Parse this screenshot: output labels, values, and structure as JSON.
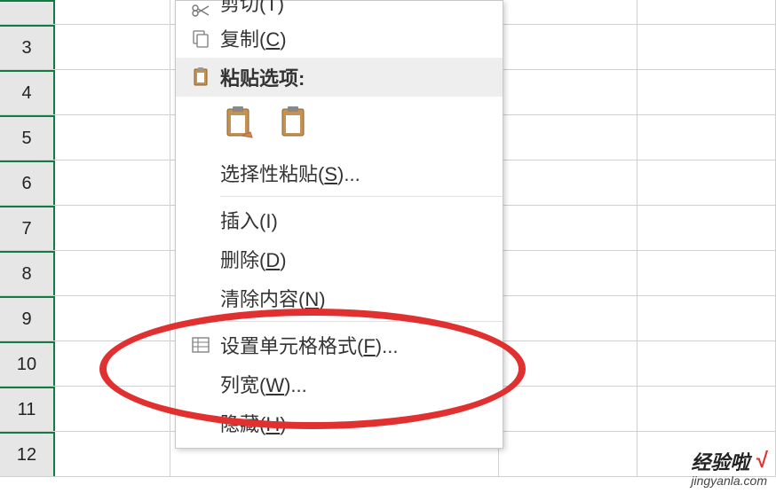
{
  "rows": [
    "",
    "3",
    "4",
    "5",
    "6",
    "7",
    "8",
    "9",
    "10",
    "11",
    "12"
  ],
  "menu": {
    "cut": "剪切(T)",
    "copy_pre": "复制(",
    "copy_u": "C",
    "copy_post": ")",
    "paste_options": "粘贴选项:",
    "paste_special_pre": "选择性粘贴(",
    "paste_special_u": "S",
    "paste_special_post": ")...",
    "insert": "插入(I)",
    "delete_pre": "删除(",
    "delete_u": "D",
    "delete_post": ")",
    "clear_pre": "清除内容(",
    "clear_u": "N",
    "clear_post": ")",
    "format_pre": "设置单元格格式(",
    "format_u": "F",
    "format_post": ")...",
    "colwidth_pre": "列宽(",
    "colwidth_u": "W",
    "colwidth_post": ")...",
    "hide_pre": "隐藏(",
    "hide_u": "H",
    "hide_post": ")"
  },
  "watermark": {
    "top": "经验啦",
    "check": "√",
    "bottom": "jingyanla.com"
  }
}
